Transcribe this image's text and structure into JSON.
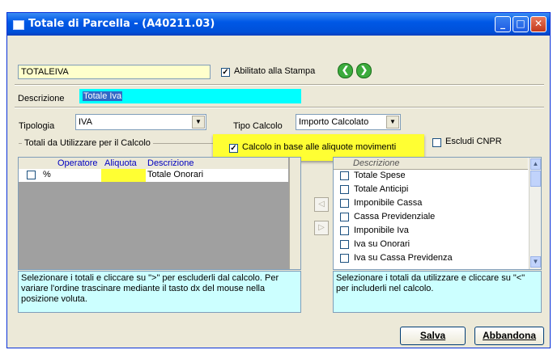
{
  "window": {
    "title": "Totale di Parcella - (A40211.03)",
    "controls": [
      "minimize",
      "maximize",
      "close"
    ]
  },
  "code": {
    "value": "TOTALEIVA"
  },
  "print": {
    "label": "Abilitato alla Stampa",
    "checked": true
  },
  "descrizione": {
    "label": "Descrizione",
    "value": "Totale Iva"
  },
  "tipologia": {
    "label": "Tipologia",
    "value": "IVA"
  },
  "tipo_calcolo": {
    "label": "Tipo Calcolo",
    "value": "Importo Calcolato"
  },
  "calcolo_aliquote": {
    "label": "Calcolo in base alle aliquote movimenti",
    "checked": true
  },
  "escludi_cnpr": {
    "label": "Escludi CNPR",
    "checked": false
  },
  "groupbox": {
    "label": "Totali da Utilizzare per il Calcolo"
  },
  "left_grid": {
    "headers": [
      "Operatore",
      "Aliquota",
      "Descrizione"
    ],
    "rows": [
      {
        "operatore": "%",
        "aliquota": "",
        "descrizione": "Totale Onorari"
      }
    ]
  },
  "right_list": {
    "header": "Descrizione",
    "items": [
      "Totale Spese",
      "Totale Anticipi",
      "Imponibile Cassa",
      "Cassa Previdenziale",
      "Imponibile Iva",
      "Iva su Onorari",
      "Iva su Cassa Previdenza"
    ]
  },
  "move_buttons": {
    "left": "◁",
    "right": "▷"
  },
  "left_hint": "Selezionare i totali e cliccare su \">\" per escluderli dal calcolo. Per variare l'ordine trascinare mediante il tasto dx del mouse nella posizione voluta.",
  "right_hint": "Selezionare i totali da utilizzare e cliccare su \"<\" per includerli nel calcolo.",
  "buttons": {
    "save": "Salva",
    "cancel": "Abbandona"
  },
  "colors": {
    "title_bar": "#0058e6",
    "highlight": "#ffff33",
    "selection": "#00ffff",
    "hint_bg": "#ccffff",
    "header_text": "#0000c0"
  }
}
